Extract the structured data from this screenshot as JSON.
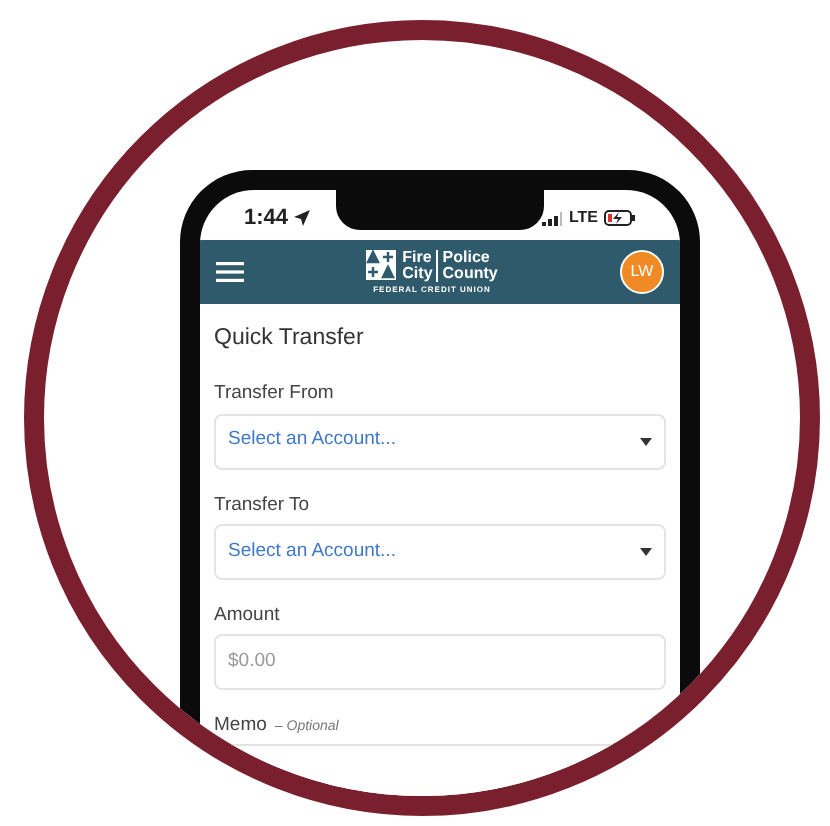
{
  "status_bar": {
    "time": "1:44",
    "network": "LTE"
  },
  "header": {
    "logo_words": [
      "Fire",
      "Police",
      "City",
      "County"
    ],
    "logo_tagline": "FEDERAL CREDIT UNION",
    "avatar_initials": "LW"
  },
  "page_title": "Quick Transfer",
  "fields": [
    {
      "kind": "select",
      "label": "Transfer From",
      "placeholder": "Select an Account..."
    },
    {
      "kind": "select",
      "label": "Transfer To",
      "placeholder": "Select an Account..."
    },
    {
      "kind": "input",
      "label": "Amount",
      "placeholder": "$0.00"
    },
    {
      "kind": "input",
      "label": "Memo",
      "hint": "– Optional"
    }
  ]
}
